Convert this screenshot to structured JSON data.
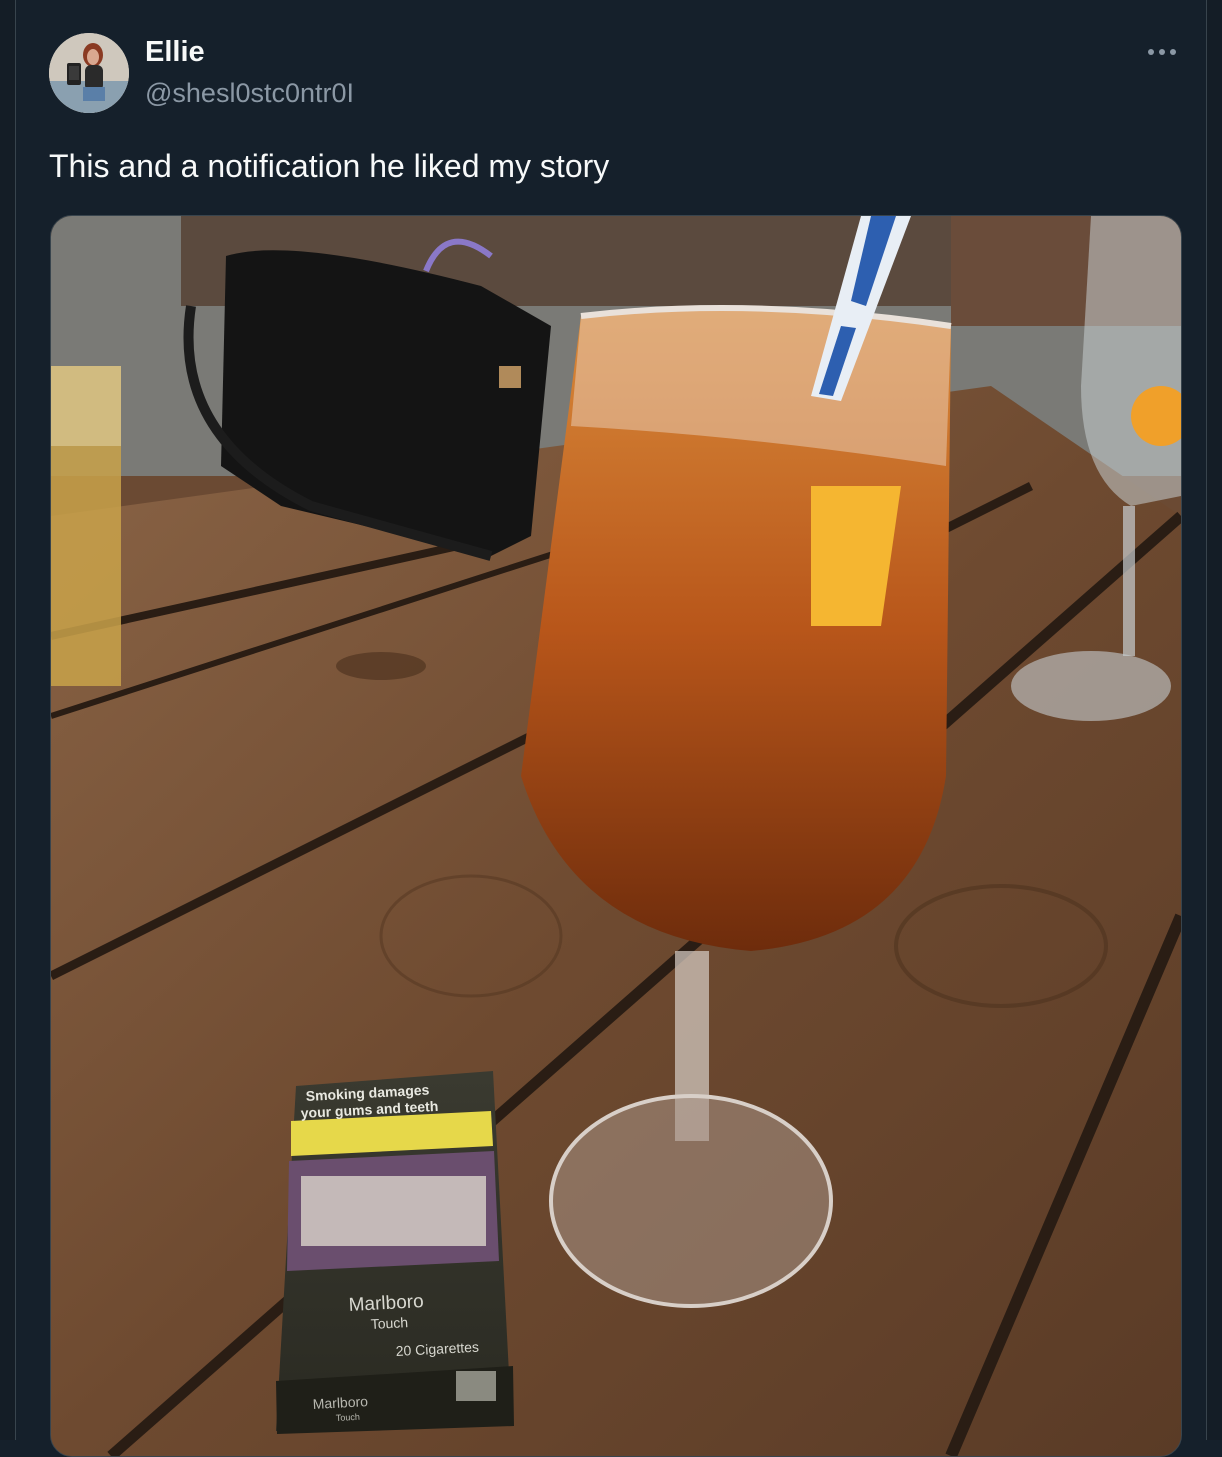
{
  "tweet": {
    "author": {
      "display_name": "Ellie",
      "handle": "@shesl0stc0ntr0I"
    },
    "text": "This and a notification he liked my story",
    "more_icon": "more-horizontal-icon"
  },
  "photo": {
    "pack": {
      "warning_line1": "Smoking damages",
      "warning_line2": "your gums and teeth",
      "brand": "Marlboro",
      "variant": "Touch",
      "count": "20 Cigarettes",
      "side_brand": "Marlboro",
      "side_variant": "Touch"
    }
  },
  "colors": {
    "background": "#15202b",
    "text_primary": "#f7f9f9",
    "text_secondary": "#8b98a5",
    "border": "#38444d"
  }
}
